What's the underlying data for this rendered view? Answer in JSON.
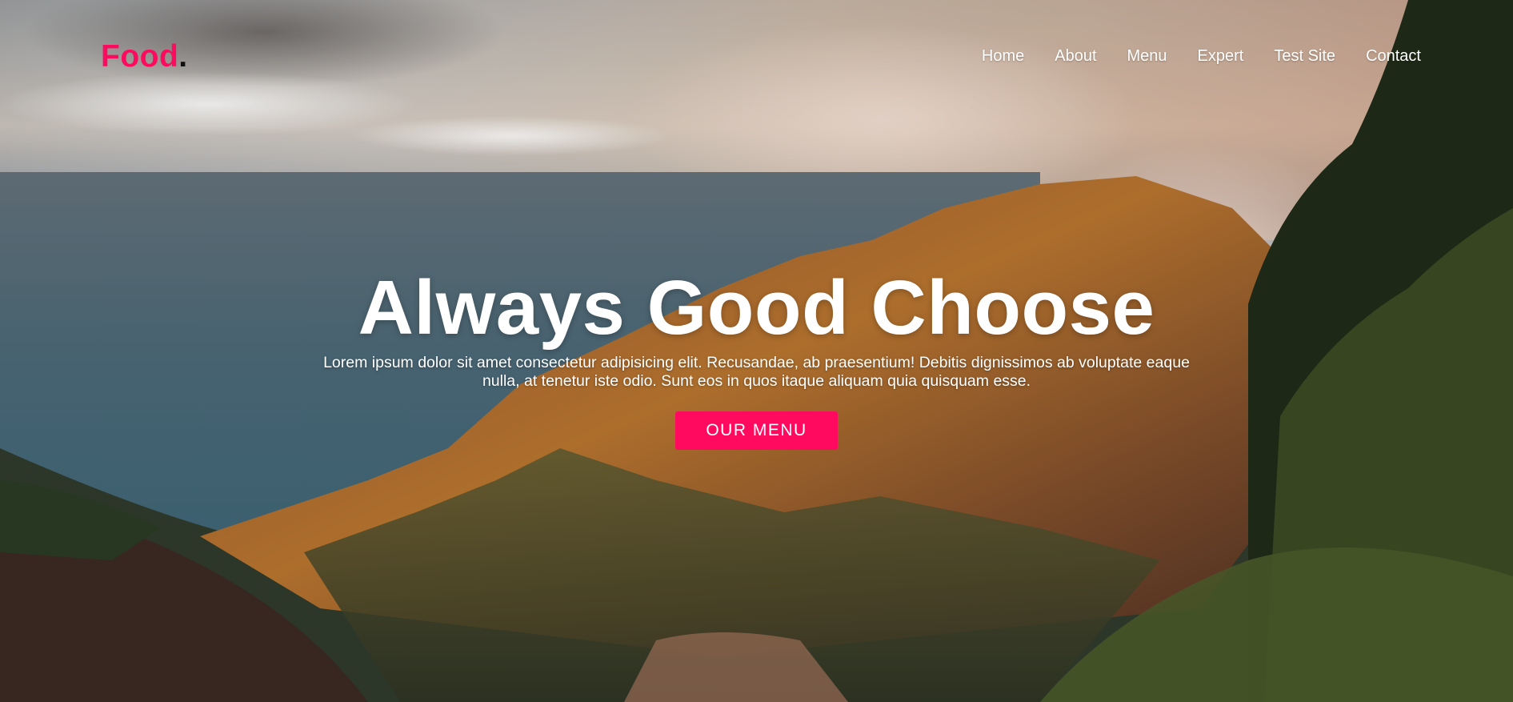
{
  "brand": {
    "name": "Food",
    "dot": ".",
    "accent_color": "#ff0a5e"
  },
  "nav": {
    "items": [
      {
        "label": "Home"
      },
      {
        "label": "About"
      },
      {
        "label": "Menu"
      },
      {
        "label": "Expert"
      },
      {
        "label": "Test Site"
      },
      {
        "label": "Contact"
      }
    ]
  },
  "hero": {
    "headline": "Always Good Choose",
    "description": "Lorem ipsum dolor sit amet consectetur adipisicing elit. Recusandae, ab praesentium! Debitis dignissimos ab voluptate eaque nulla, at tenetur iste odio. Sunt eos in quos itaque aliquam quia quisquam esse.",
    "cta_label": "OUR MENU",
    "background": "mountain-coastline-photo"
  }
}
